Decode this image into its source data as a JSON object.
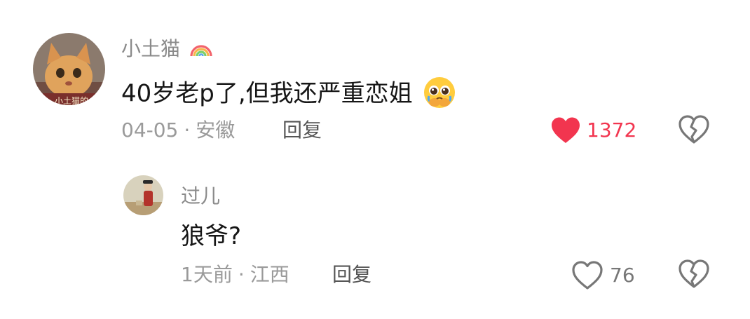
{
  "comments": [
    {
      "username": "小土猫",
      "username_badge_icon": "rainbow-icon",
      "text": "40岁老p了,但我还严重恋姐",
      "text_emoji_icon": "pleading-face-emoji-icon",
      "date": "04-05",
      "location": "安徽",
      "reply_label": "回复",
      "like_count": "1372",
      "liked": true,
      "like_color": "#f2354f",
      "avatar_caption": "小土猫的"
    },
    {
      "username": "过儿",
      "text": "狼爷?",
      "date": "1天前",
      "location": "江西",
      "reply_label": "回复",
      "like_count": "76",
      "liked": false
    }
  ],
  "meta_separator": "·",
  "icons": {
    "like_filled": "heart-filled-icon",
    "like_outline": "heart-outline-icon",
    "dislike": "broken-heart-icon"
  },
  "colors": {
    "text_primary": "#161616",
    "text_secondary": "#9a9a9a",
    "like_active": "#f2354f"
  }
}
